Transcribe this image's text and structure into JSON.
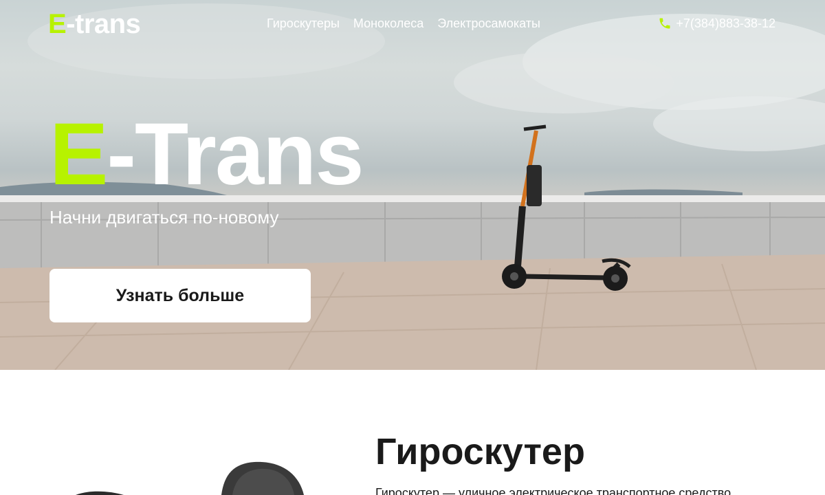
{
  "header": {
    "logo_accent": "E",
    "logo_rest": "-trans",
    "nav": [
      {
        "label": "Гироскутеры"
      },
      {
        "label": "Моноколеса"
      },
      {
        "label": "Электросамокаты"
      }
    ],
    "phone": "+7(384)883-38-12"
  },
  "hero": {
    "title_accent": "E",
    "title_rest": "-Trans",
    "subtitle": "Начни двигаться по-новому",
    "cta_label": "Узнать больше"
  },
  "section": {
    "title": "Гироскутер",
    "text": "Гироскутер — уличное электрическое транспортное средство"
  },
  "colors": {
    "accent": "#b7f200",
    "text_dark": "#1a1a1a",
    "button_bg": "#ffffff"
  },
  "icons": {
    "phone": "phone-icon"
  }
}
